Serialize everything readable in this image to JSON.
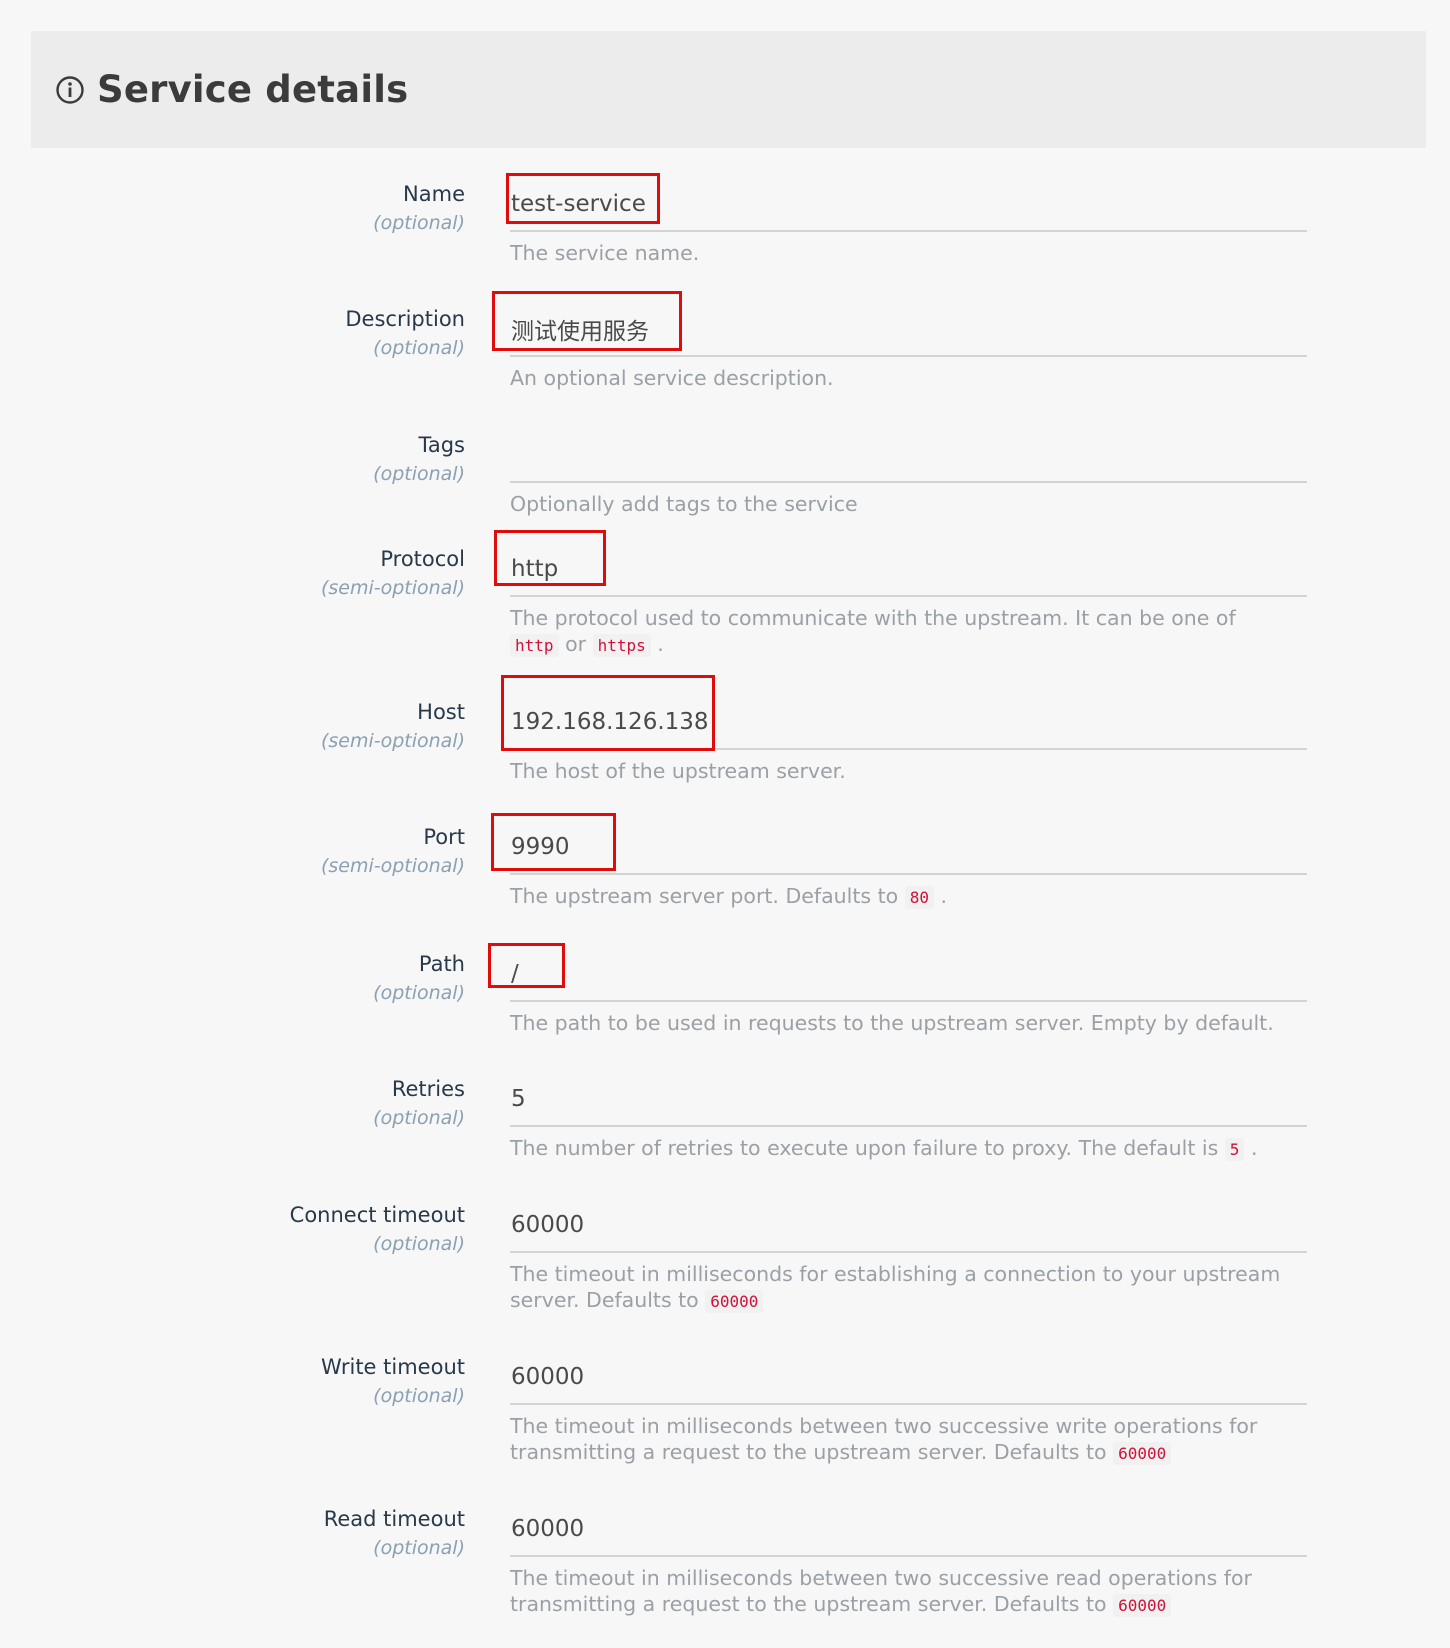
{
  "header": {
    "title": "Service details",
    "icon": "info-circle-icon"
  },
  "fields": {
    "name": {
      "label": "Name",
      "hint": "(optional)",
      "value": "test-service",
      "help": "The service name."
    },
    "description": {
      "label": "Description",
      "hint": "(optional)",
      "value": "测试使用服务",
      "help": "An optional service description."
    },
    "tags": {
      "label": "Tags",
      "hint": "(optional)",
      "value": "",
      "help": "Optionally add tags to the service"
    },
    "protocol": {
      "label": "Protocol",
      "hint": "(semi-optional)",
      "value": "http",
      "help_before": "The protocol used to communicate with the upstream. It can be one of",
      "code1": "http",
      "help_middle": "or",
      "code2": "https",
      "help_after": "."
    },
    "host": {
      "label": "Host",
      "hint": "(semi-optional)",
      "value": "192.168.126.138",
      "help": "The host of the upstream server."
    },
    "port": {
      "label": "Port",
      "hint": "(semi-optional)",
      "value": "9990",
      "help_before": "The upstream server port. Defaults to",
      "code": "80",
      "help_after": "."
    },
    "path": {
      "label": "Path",
      "hint": "(optional)",
      "value": "/",
      "help": "The path to be used in requests to the upstream server. Empty by default."
    },
    "retries": {
      "label": "Retries",
      "hint": "(optional)",
      "value": "5",
      "help_before": "The number of retries to execute upon failure to proxy. The default is",
      "code": "5",
      "help_after": "."
    },
    "connect_timeout": {
      "label": "Connect timeout",
      "hint": "(optional)",
      "value": "60000",
      "help_before": "The timeout in milliseconds for establishing a connection to your upstream server. Defaults to",
      "code": "60000"
    },
    "write_timeout": {
      "label": "Write timeout",
      "hint": "(optional)",
      "value": "60000",
      "help_before": "The timeout in milliseconds between two successive write operations for transmitting a request to the upstream server. Defaults to",
      "code": "60000"
    },
    "read_timeout": {
      "label": "Read timeout",
      "hint": "(optional)",
      "value": "60000",
      "help_before": "The timeout in milliseconds between two successive read operations for transmitting a request to the upstream server. Defaults to",
      "code": "60000"
    }
  },
  "colors": {
    "highlight_box": "#e00c0c",
    "code_text": "#d0113a",
    "label_text": "#27394a",
    "hint_text": "#8aa0b3",
    "help_text": "#9aa0a6"
  }
}
